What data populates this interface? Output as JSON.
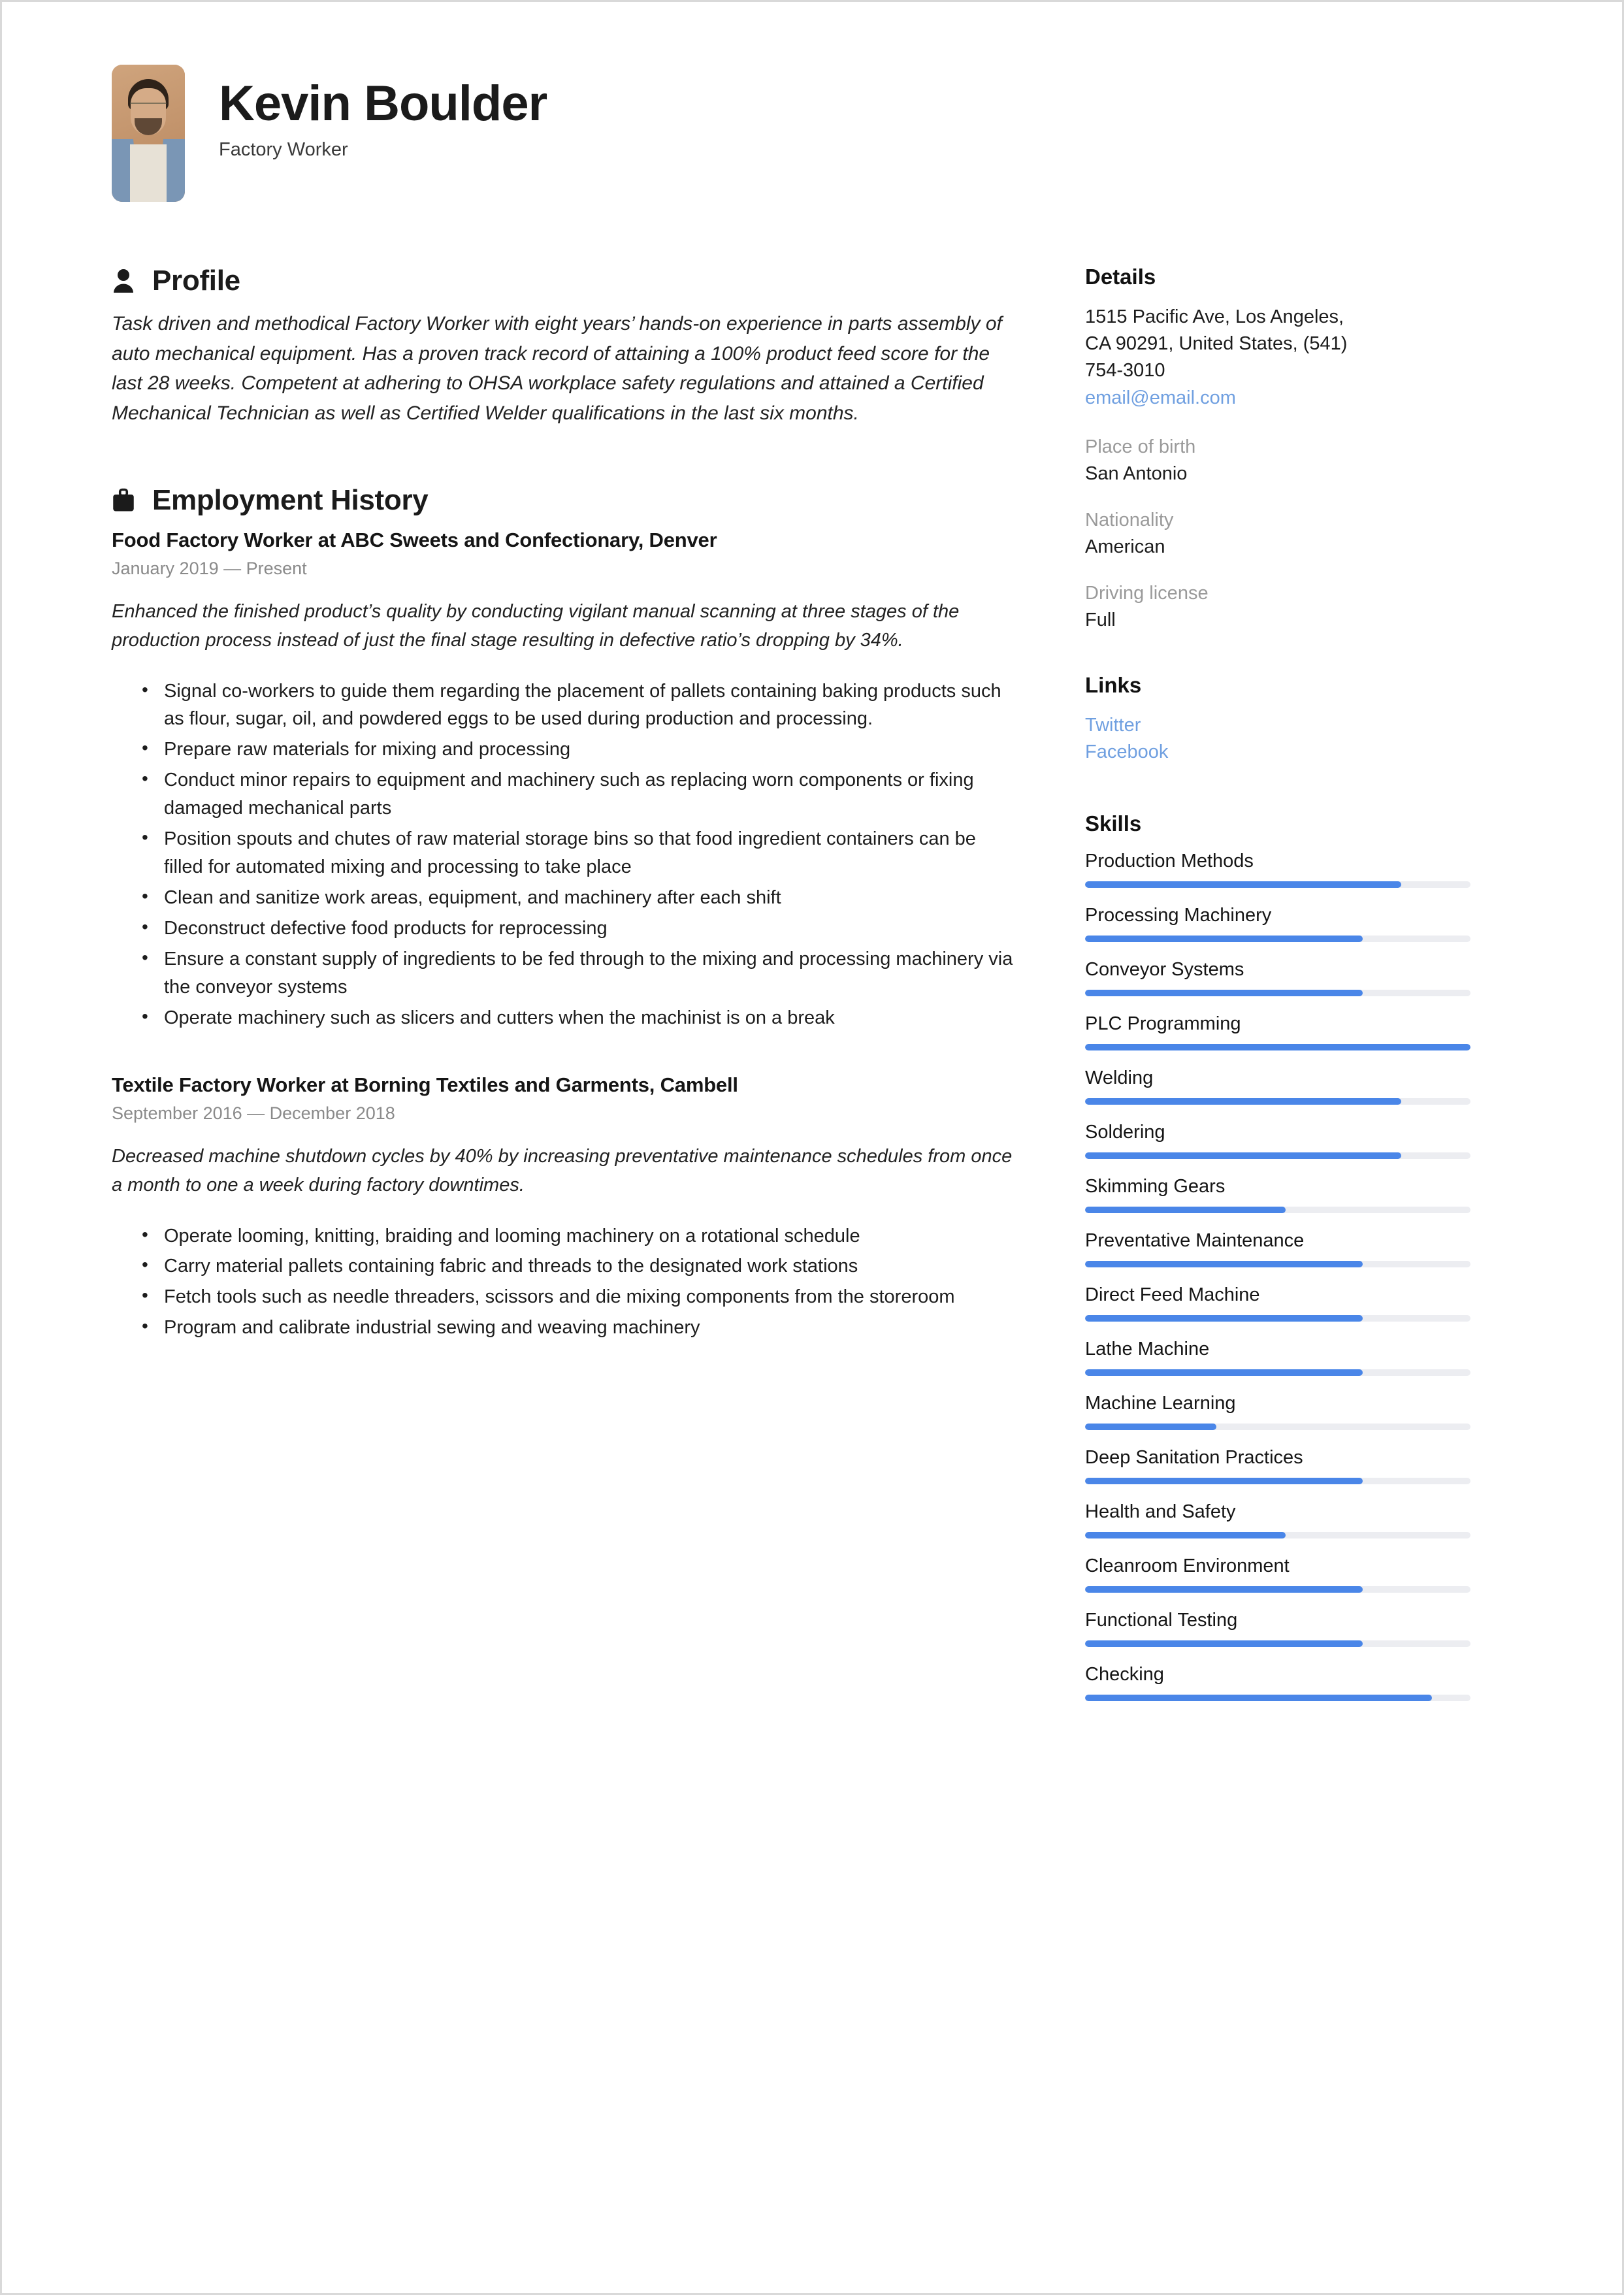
{
  "header": {
    "name": "Kevin Boulder",
    "role": "Factory Worker",
    "avatar_alt": "profile-photo"
  },
  "accent_color": "#4a86e8",
  "link_color": "#6f9fe0",
  "profile": {
    "heading": "Profile",
    "icon": "person-icon",
    "summary": "Task driven and methodical Factory Worker with eight years’ hands-on experience in parts assembly of auto mechanical equipment. Has a proven track record of attaining a 100% product feed score for the last 28 weeks. Competent at adhering to OHSA workplace safety regulations and attained a Certified Mechanical Technician as well as Certified Welder qualifications in the last six months."
  },
  "employment": {
    "heading": "Employment History",
    "icon": "briefcase-icon",
    "jobs": [
      {
        "title": "Food Factory Worker at  ABC Sweets and Confectionary, Denver",
        "date": "January 2019 — Present",
        "description": "Enhanced the finished product’s quality by conducting vigilant manual scanning at three stages of the production process instead of just the final stage resulting in defective ratio’s dropping by 34%.",
        "bullets": [
          "Signal co-workers to guide them regarding the placement of pallets containing baking products such as flour, sugar, oil, and powdered eggs to be used during production and processing.",
          "Prepare raw materials for mixing and processing",
          "Conduct minor repairs to equipment and machinery such as replacing worn components or fixing damaged mechanical parts",
          "Position spouts and chutes of raw material storage bins so that food ingredient containers can be filled for automated mixing and processing to take place",
          "Clean and sanitize work areas, equipment, and machinery after each shift",
          "Deconstruct defective food products for reprocessing",
          "Ensure a constant supply of ingredients to be fed through to the mixing and processing machinery via the conveyor systems",
          "Operate machinery such as slicers and cutters when the machinist is on a break"
        ]
      },
      {
        "title": "Textile Factory Worker at  Borning Textiles and Garments, Cambell",
        "date": "September 2016 — December 2018",
        "description": "Decreased machine shutdown cycles by 40% by increasing preventative maintenance schedules from once a month to one a week during factory downtimes.",
        "bullets": [
          "Operate looming, knitting, braiding and looming machinery on a rotational schedule",
          "Carry material pallets containing fabric and threads to the designated work stations",
          "Fetch tools such as needle threaders, scissors and die mixing components from the storeroom",
          "Program and calibrate industrial sewing and weaving machinery"
        ]
      }
    ]
  },
  "details": {
    "heading": "Details",
    "address_lines": [
      "1515 Pacific Ave, Los Angeles,",
      "CA 90291, United States, (541)",
      "754-3010"
    ],
    "email": "email@email.com",
    "fields": [
      {
        "label": "Place of birth",
        "value": "San Antonio"
      },
      {
        "label": "Nationality",
        "value": "American"
      },
      {
        "label": "Driving license",
        "value": "Full"
      }
    ]
  },
  "links": {
    "heading": "Links",
    "items": [
      {
        "label": "Twitter"
      },
      {
        "label": "Facebook"
      }
    ]
  },
  "skills": {
    "heading": "Skills",
    "items": [
      {
        "name": "Production Methods",
        "level": 82
      },
      {
        "name": "Processing Machinery",
        "level": 72
      },
      {
        "name": "Conveyor Systems",
        "level": 72
      },
      {
        "name": "PLC Programming",
        "level": 100
      },
      {
        "name": "Welding",
        "level": 82
      },
      {
        "name": "Soldering",
        "level": 82
      },
      {
        "name": "Skimming Gears",
        "level": 52
      },
      {
        "name": "Preventative Maintenance",
        "level": 72
      },
      {
        "name": "Direct Feed Machine",
        "level": 72
      },
      {
        "name": "Lathe Machine",
        "level": 72
      },
      {
        "name": "Machine Learning",
        "level": 34
      },
      {
        "name": "Deep Sanitation Practices",
        "level": 72
      },
      {
        "name": "Health and Safety",
        "level": 52
      },
      {
        "name": "Cleanroom Environment",
        "level": 72
      },
      {
        "name": "Functional Testing",
        "level": 72
      },
      {
        "name": "Checking",
        "level": 90
      }
    ]
  }
}
